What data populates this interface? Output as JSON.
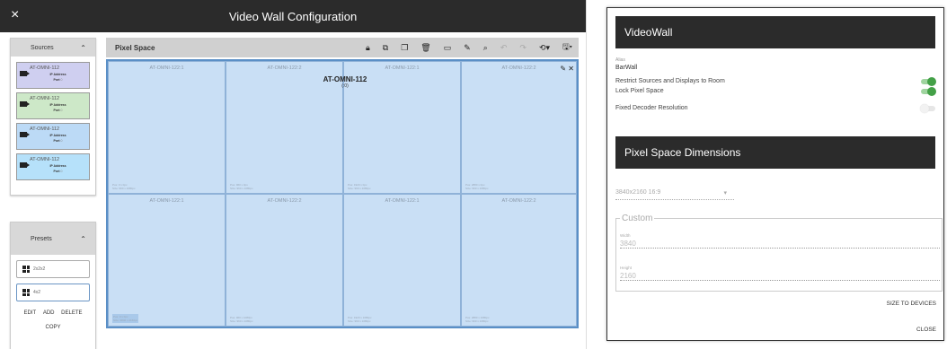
{
  "window": {
    "title": "Video Wall Configuration",
    "close_icon": "×"
  },
  "sources": {
    "header": "Sources",
    "items": [
      {
        "name": "AT-OMNI-112",
        "ip_label": "IP Address",
        "port_label": "Port",
        "port_value": "0",
        "color": "#cfcff0"
      },
      {
        "name": "AT-OMNI-112",
        "ip_label": "IP Address",
        "port_label": "Port",
        "port_value": "0",
        "color": "#cde8c8"
      },
      {
        "name": "AT-OMNI-112",
        "ip_label": "IP Address",
        "port_label": "Port",
        "port_value": "0",
        "color": "#bcdaf6"
      },
      {
        "name": "AT-OMNI-112",
        "ip_label": "IP Address",
        "port_label": "Port",
        "port_value": "0",
        "color": "#b6e1fa"
      }
    ]
  },
  "presets": {
    "header": "Presets",
    "items": [
      {
        "label": "2x2x2"
      },
      {
        "label": "4x2"
      }
    ],
    "actions": {
      "edit": "EDIT",
      "add": "ADD",
      "delete": "DELETE",
      "copy": "COPY"
    }
  },
  "pixel_space": {
    "header": "Pixel Space",
    "overlay": {
      "name": "AT-OMNI-112",
      "coords": "(:0)"
    },
    "cells": [
      {
        "name": "AT-OMNI-122:1",
        "info1": "Pos: 0 x 0px",
        "info2": "Size: 960 x 1080px"
      },
      {
        "name": "AT-OMNI-122:2",
        "info1": "Pos: 960 x 0px",
        "info2": "Size: 960 x 1080px"
      },
      {
        "name": "AT-OMNI-122:1",
        "info1": "Pos: 1920 x 0px",
        "info2": "Size: 960 x 1080px"
      },
      {
        "name": "AT-OMNI-122:2",
        "info1": "Pos: 2880 x 0px",
        "info2": "Size: 960 x 1080px"
      },
      {
        "name": "AT-OMNI-122:1",
        "info1": "Pos: 0 x 0px",
        "info2": "Size: 3840 x 2160px"
      },
      {
        "name": "AT-OMNI-122:2",
        "info1": "Pos: 960 x 1080px",
        "info2": "Size: 960 x 1080px"
      },
      {
        "name": "AT-OMNI-122:1",
        "info1": "Pos: 1920 x 1080px",
        "info2": "Size: 960 x 1080px"
      },
      {
        "name": "AT-OMNI-122:2",
        "info1": "Pos: 2880 x 1080px",
        "info2": "Size: 960 x 1080px"
      }
    ]
  },
  "dialog": {
    "videowall_title": "VideoWall",
    "alias_label": "Alias",
    "alias_value": "BarWall",
    "restrict_label": "Restrict Sources and Displays to Room",
    "lock_label": "Lock Pixel Space",
    "fixed_label": "Fixed Decoder Resolution",
    "dimensions_title": "Pixel Space Dimensions",
    "resolution_value": "3840x2160 16:9",
    "custom_label": "Custom",
    "width_label": "Width",
    "width_value": "3840",
    "height_label": "Height",
    "height_value": "2160",
    "size_to_devices": "SIZE TO DEVICES",
    "close": "CLOSE"
  }
}
